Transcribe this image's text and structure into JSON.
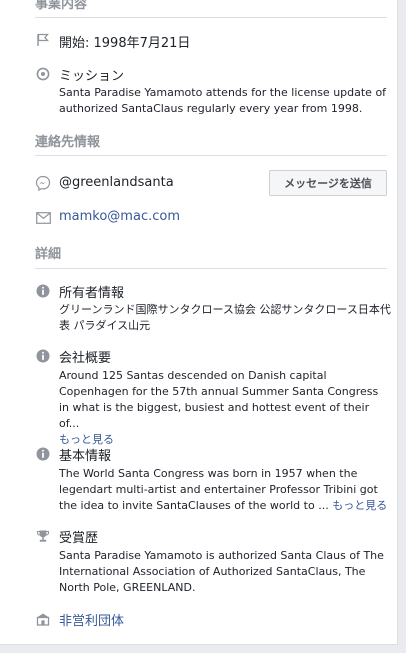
{
  "sections": {
    "business_title": "事業内容",
    "contact_title": "連絡先情報",
    "details_title": "詳細"
  },
  "business": {
    "start_label": "開始: 1998年7月21日",
    "mission_title": "ミッション",
    "mission_text": "Santa Paradise Yamamoto attends for the license update of authorized SantaClaus regularly every year from 1998."
  },
  "contact": {
    "messenger_handle": "@greenlandsanta",
    "message_button": "メッセージを送信",
    "email": "mamko@mac.com"
  },
  "details": {
    "owner_title": "所有者情報",
    "owner_text": "グリーンランド国際サンタクロース協会 公認サンタクロース日本代表 パラダイス山元",
    "overview_title": "会社概要",
    "overview_text": "Around 125 Santas descended on Danish capital Copenhagen for the 57th annual Summer Santa Congress in what is the biggest, busiest and hottest event of their of...",
    "overview_more": "もっと見る",
    "basic_title": "基本情報",
    "basic_text": "The World Santa Congress was born in 1957 when the legendart multi-artist and entertainer Professor Tribini got the idea to invite SantaClauses of the world to ...",
    "basic_more": "もっと見る",
    "awards_title": "受賞歴",
    "awards_text": "Santa Paradise Yamamoto is authorized Santa Claus of The International Association of Authorized SantaClaus, The North Pole, GREENLAND.",
    "nonprofit_label": "非営利団体"
  },
  "colors": {
    "link": "#385898",
    "icon": "#90949c",
    "section_title": "#90949c"
  }
}
